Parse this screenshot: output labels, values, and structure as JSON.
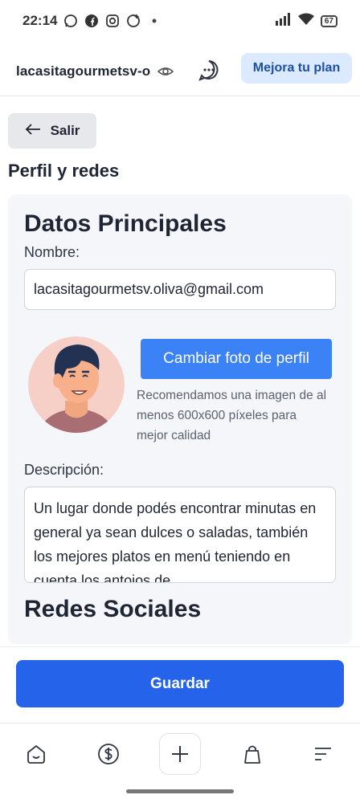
{
  "status_bar": {
    "time": "22:14",
    "battery": "67"
  },
  "header": {
    "store_name": "lacasitagourmetsv-o",
    "upgrade_label": "Mejora tu plan"
  },
  "back_label": "Salir",
  "page_title": "Perfil y redes",
  "datos": {
    "title": "Datos Principales",
    "name_label": "Nombre:",
    "name_value": "lacasitagourmetsv.oliva@gmail.com",
    "change_photo_label": "Cambiar foto de perfil",
    "photo_hint": "Recomendamos una imagen de al menos 600x600 píxeles para mejor calidad",
    "description_label": "Descripción:",
    "description_value": "Un lugar donde podés encontrar minutas en general ya sean dulces o saladas, también los mejores platos en menú teniendo en cuenta los antojos de"
  },
  "redes": {
    "title": "Redes Sociales"
  },
  "save_label": "Guardar",
  "colors": {
    "primary": "#2563eb",
    "photo_button": "#3b82f6",
    "upgrade_bg": "#dbeafe",
    "upgrade_text": "#1d4fa3",
    "card_bg": "#f4f6f9"
  },
  "icons": {
    "nav": [
      "home-icon",
      "dollar-icon",
      "plus-icon",
      "shopping-bag-icon",
      "menu-icon"
    ]
  }
}
